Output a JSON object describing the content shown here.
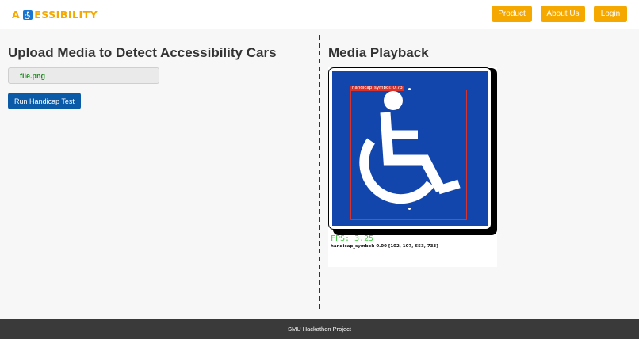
{
  "header": {
    "logo": {
      "prefix": "A",
      "suffix": "ESSIBILITY",
      "icon": "wheelchair-icon"
    },
    "nav": [
      {
        "label": "Product"
      },
      {
        "label": "About Us"
      },
      {
        "label": "Login"
      }
    ]
  },
  "upload": {
    "title": "Upload Media to Detect Accessibility Cars",
    "file_name": "file.png",
    "run_button": "Run Handicap Test"
  },
  "playback": {
    "title": "Media Playback",
    "detection_label": "handicap_symbol: 0.73",
    "fps_text": "FPS: 3.25",
    "detection_line": "handicap_symbol: 0.00 [102, 107, 653, 733]"
  },
  "footer": {
    "text": "SMU Hackathon Project"
  },
  "colors": {
    "accent": "#f5a800",
    "primary_button": "#0b5aa8",
    "sign_blue": "#1346ad",
    "detection_box": "#d9322a",
    "fps_green": "#3ccf3c",
    "footer_bg": "#3a3a3a"
  }
}
